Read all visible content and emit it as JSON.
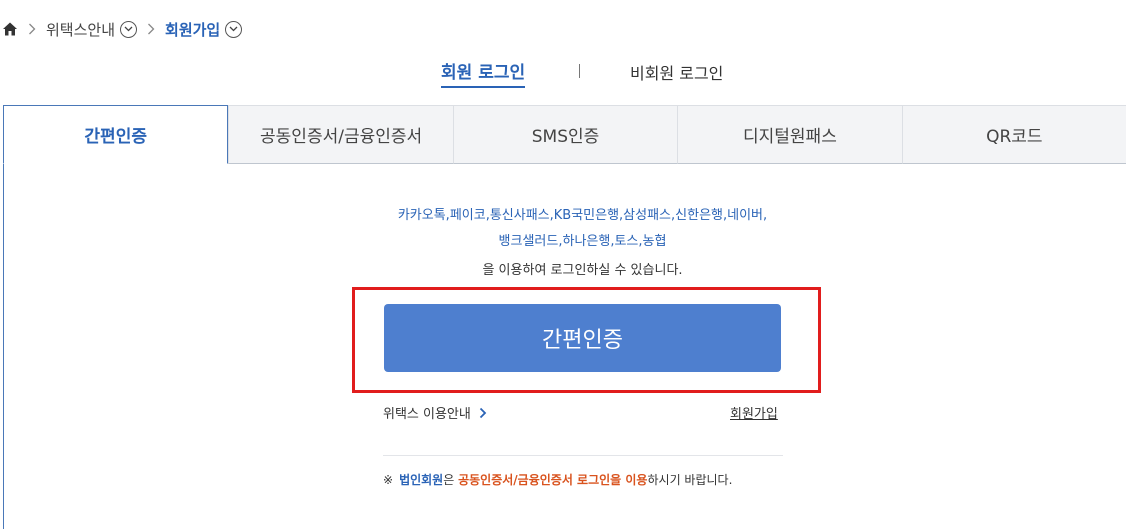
{
  "breadcrumb": {
    "items": [
      "위택스안내",
      "회원가입"
    ]
  },
  "login_type": {
    "member": "회원 로그인",
    "guest": "비회원 로그인"
  },
  "auth_tabs": [
    {
      "label": "간편인증",
      "active": true
    },
    {
      "label": "공동인증서/금융인증서",
      "active": false
    },
    {
      "label": "SMS인증",
      "active": false
    },
    {
      "label": "디지털원패스",
      "active": false
    },
    {
      "label": "QR코드",
      "active": false
    }
  ],
  "providers": {
    "line1": "카카오톡,페이코,통신사패스,KB국민은행,삼성패스,신한은행,네이버,",
    "line2": "뱅크샐러드,하나은행,토스,농협",
    "suffix": "을 이용하여 로그인하실 수 있습니다."
  },
  "main_button": "간편인증",
  "links": {
    "info": "위택스 이용안내",
    "join": "회원가입"
  },
  "notice": {
    "mark": "※",
    "em1": "법인회원",
    "t1": "은 ",
    "em2": "공동인증서/금융인증서 로그인을 이용",
    "t2": "하시기 바랍니다."
  },
  "colors": {
    "accent": "#2a63b6",
    "button": "#4e7fcf",
    "highlight": "#e11d1d",
    "notice_emphasis": "#d9531e"
  }
}
